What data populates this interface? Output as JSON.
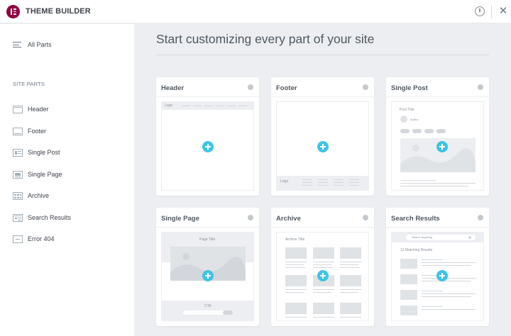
{
  "app": {
    "title": "THEME BUILDER",
    "close_glyph": "✕",
    "icons": {
      "logo": "elementor-logo",
      "info": "info-icon",
      "close": "close-icon"
    },
    "brand_color": "#92003b",
    "accent_color": "#3cc4e4"
  },
  "sidebar": {
    "all_parts_label": "All Parts",
    "section_title": "SITE PARTS",
    "items": [
      {
        "label": "Header",
        "icon": "header-icon"
      },
      {
        "label": "Footer",
        "icon": "footer-icon"
      },
      {
        "label": "Single Post",
        "icon": "single-post-icon"
      },
      {
        "label": "Single Page",
        "icon": "single-page-icon"
      },
      {
        "label": "Archive",
        "icon": "archive-icon"
      },
      {
        "label": "Search Results",
        "icon": "search-results-icon"
      },
      {
        "label": "Error 404",
        "icon": "error-404-icon"
      }
    ]
  },
  "main": {
    "title": "Start customizing every part of your site",
    "cards": [
      {
        "title": "Header",
        "preview_text": [
          "Logo"
        ]
      },
      {
        "title": "Footer",
        "preview_text": [
          "Logo"
        ]
      },
      {
        "title": "Single Post",
        "preview_text": [
          "Post Title",
          "Author"
        ]
      },
      {
        "title": "Single Page",
        "preview_text": [
          "Page Title",
          "CTA"
        ]
      },
      {
        "title": "Archive",
        "preview_text": [
          "Archive Title"
        ]
      },
      {
        "title": "Search Results",
        "preview_text": [
          "Search anything",
          "12 Matching Results"
        ]
      }
    ]
  }
}
